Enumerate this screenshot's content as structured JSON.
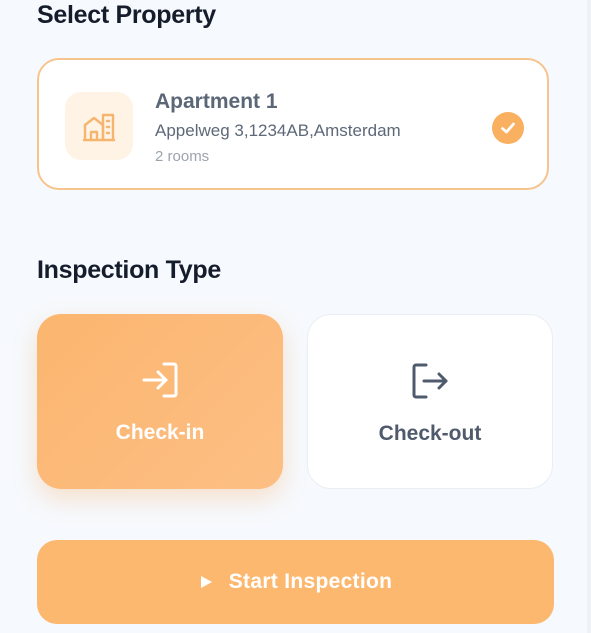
{
  "select_property": {
    "title": "Select Property",
    "property": {
      "name": "Apartment 1",
      "address": "Appelweg 3,1234AB,Amsterdam",
      "rooms": "2 rooms",
      "icon": "building-icon",
      "selected": true
    }
  },
  "inspection_type": {
    "title": "Inspection Type",
    "options": [
      {
        "label": "Check-in",
        "icon": "login-arrow-icon",
        "selected": true
      },
      {
        "label": "Check-out",
        "icon": "logout-arrow-icon",
        "selected": false
      }
    ]
  },
  "start_button": {
    "label": "Start Inspection",
    "icon": "play-icon"
  },
  "colors": {
    "accent": "#fbb56f",
    "accent_border": "#f6c48c",
    "accent_soft": "#fff3e6",
    "background": "#f6f9fd",
    "text_dark": "#151c2b",
    "text_muted": "#5d6878"
  }
}
